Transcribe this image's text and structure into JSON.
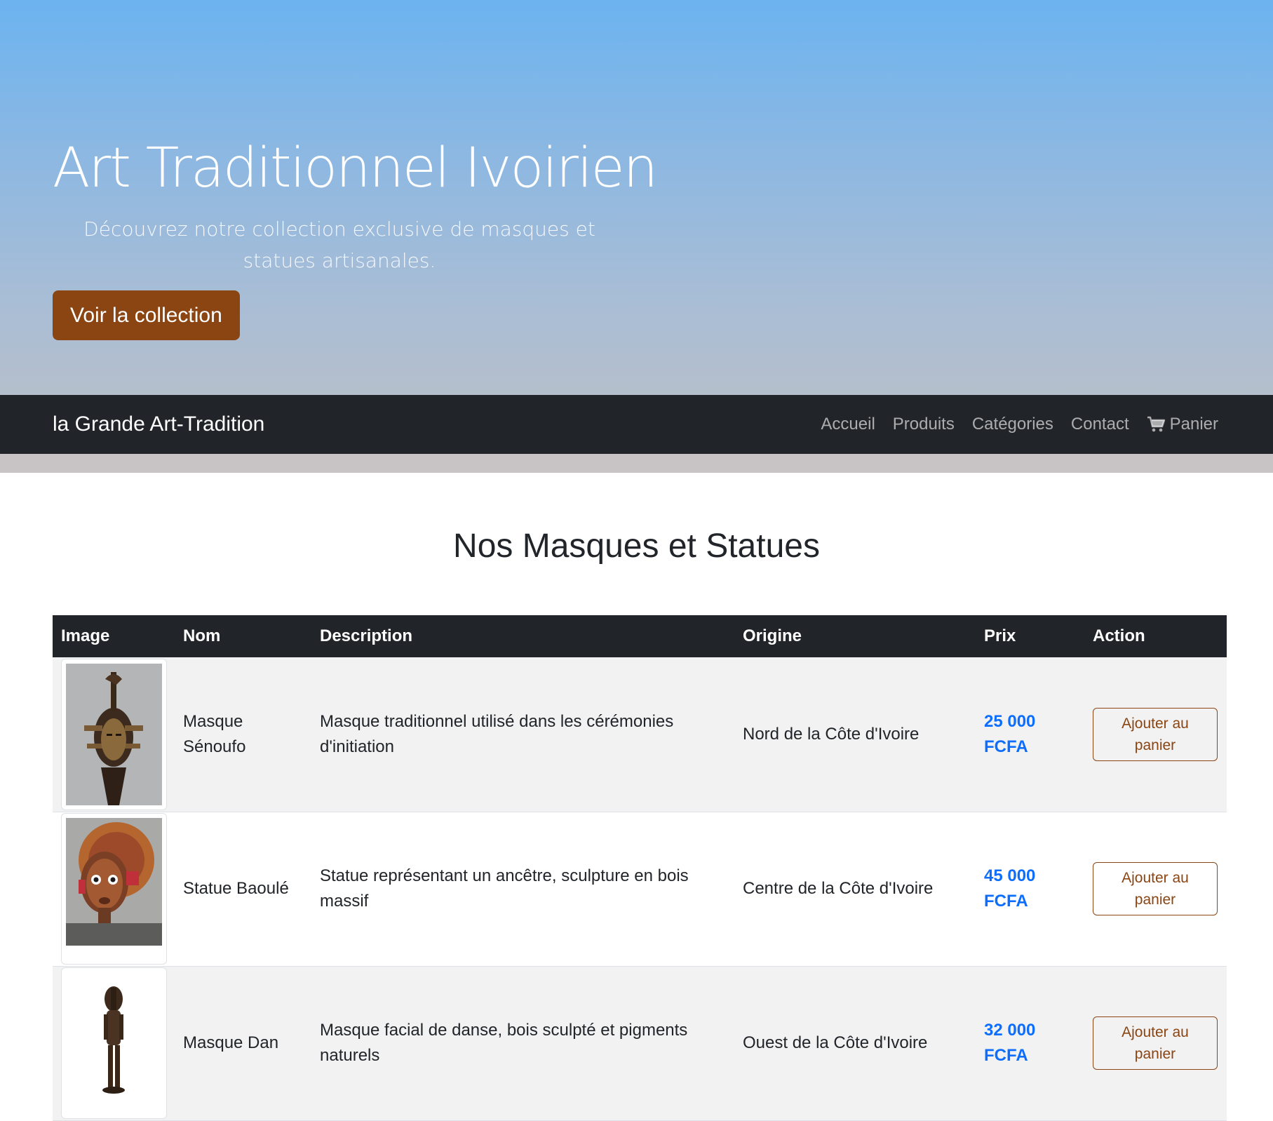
{
  "hero": {
    "title": "Art Traditionnel Ivoirien",
    "subtitle": "Découvrez notre collection exclusive de masques et statues artisanales.",
    "cta_label": "Voir la collection"
  },
  "navbar": {
    "brand": "la Grande Art-Tradition",
    "links": [
      "Accueil",
      "Produits",
      "Catégories",
      "Contact"
    ],
    "cart_label": "Panier",
    "cart_icon": "shopping-cart-icon"
  },
  "products": {
    "title": "Nos Masques et Statues",
    "headers": [
      "Image",
      "Nom",
      "Description",
      "Origine",
      "Prix",
      "Action"
    ],
    "rows": [
      {
        "name": "Masque Sénoufo",
        "description": "Masque traditionnel utilisé dans les cérémonies d'initiation",
        "origin": "Nord de la Côte d'Ivoire",
        "price": "25 000 FCFA",
        "action": "Ajouter au panier"
      },
      {
        "name": "Statue Baoulé",
        "description": "Statue représentant un ancêtre, sculpture en bois massif",
        "origin": "Centre de la Côte d'Ivoire",
        "price": "45 000 FCFA",
        "action": "Ajouter au panier"
      },
      {
        "name": "Masque Dan",
        "description": "Masque facial de danse, bois sculpté et pigments naturels",
        "origin": "Ouest de la Côte d'Ivoire",
        "price": "32 000 FCFA",
        "action": "Ajouter au panier"
      }
    ]
  },
  "colors": {
    "accent_brown": "#8b4513",
    "navbar_dark": "#212529",
    "price_blue": "#0d6efd"
  }
}
